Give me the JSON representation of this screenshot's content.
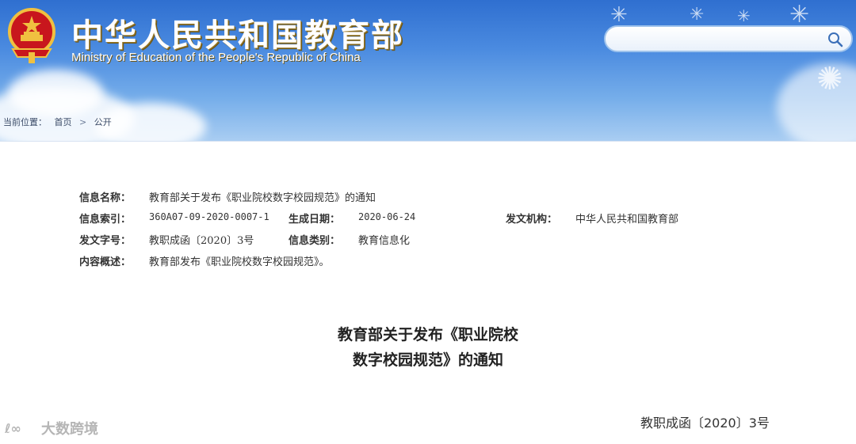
{
  "header": {
    "title_cn": "中华人民共和国教育部",
    "title_en": "Ministry of Education of the People's Republic of China",
    "emblem_icon": "national-emblem-icon"
  },
  "search": {
    "placeholder": "",
    "icon": "search-icon"
  },
  "breadcrumb": {
    "label": "当前位置：",
    "items": [
      "首页",
      "公开"
    ],
    "separator": ">"
  },
  "meta": {
    "name_label": "信息名称：",
    "name_value": "教育部关于发布《职业院校数字校园规范》的通知",
    "index_label": "信息索引：",
    "index_value": "360A07-09-2020-0007-1",
    "date_label": "生成日期：",
    "date_value": "2020-06-24",
    "org_label": "发文机构：",
    "org_value": "中华人民共和国教育部",
    "doc_label": "发文字号：",
    "doc_value": "教职成函〔2020〕3号",
    "type_label": "信息类别：",
    "type_value": "教育信息化",
    "summary_label": "内容概述：",
    "summary_value": "教育部发布《职业院校数字校园规范》。"
  },
  "document": {
    "title_line1": "教育部关于发布《职业院校",
    "title_line2": "数字校园规范》的通知",
    "number": "教职成函〔2020〕3号"
  },
  "watermark": {
    "text": "大数跨境"
  },
  "colors": {
    "header_top": "#2f6fd0",
    "header_bottom": "#a9cdf2",
    "emblem_red": "#c8161d",
    "emblem_gold": "#f0c040"
  }
}
